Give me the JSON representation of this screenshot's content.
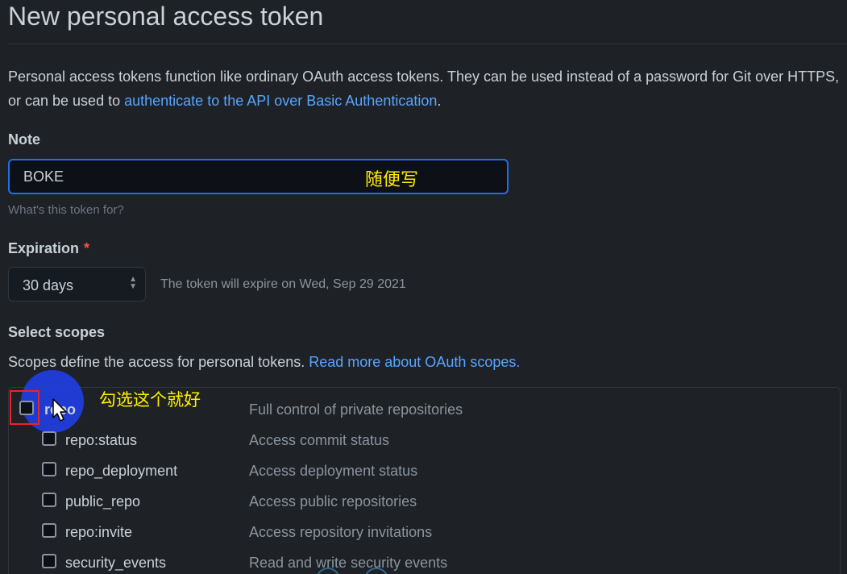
{
  "page": {
    "title": "New personal access token",
    "intro_text": "Personal access tokens function like ordinary OAuth access tokens. They can be used instead of a password for Git over HTTPS, or can be used to ",
    "intro_link": "authenticate to the API over Basic Authentication",
    "intro_end": "."
  },
  "note": {
    "label": "Note",
    "value": "BOKE",
    "hint": "What's this token for?",
    "annotation": "随便写"
  },
  "expiration": {
    "label": "Expiration",
    "required_mark": "*",
    "selected": "30 days",
    "expire_text": "The token will expire on Wed, Sep 29 2021"
  },
  "scopes": {
    "label": "Select scopes",
    "description": "Scopes define the access for personal tokens. ",
    "read_more_link": "Read more about OAuth scopes.",
    "annotation": "勾选这个就好",
    "items": [
      {
        "name": "repo",
        "desc": "Full control of private repositories",
        "checked": false
      },
      {
        "name": "repo:status",
        "desc": "Access commit status",
        "checked": false
      },
      {
        "name": "repo_deployment",
        "desc": "Access deployment status",
        "checked": false
      },
      {
        "name": "public_repo",
        "desc": "Access public repositories",
        "checked": false
      },
      {
        "name": "repo:invite",
        "desc": "Access repository invitations",
        "checked": false
      },
      {
        "name": "security_events",
        "desc": "Read and write security events",
        "checked": false
      }
    ]
  },
  "colors": {
    "background": "#1e2126",
    "link": "#58a6ff",
    "annotation": "#ffee00",
    "highlight": "#e5252a",
    "cursor_circle": "#1f3ee0"
  }
}
